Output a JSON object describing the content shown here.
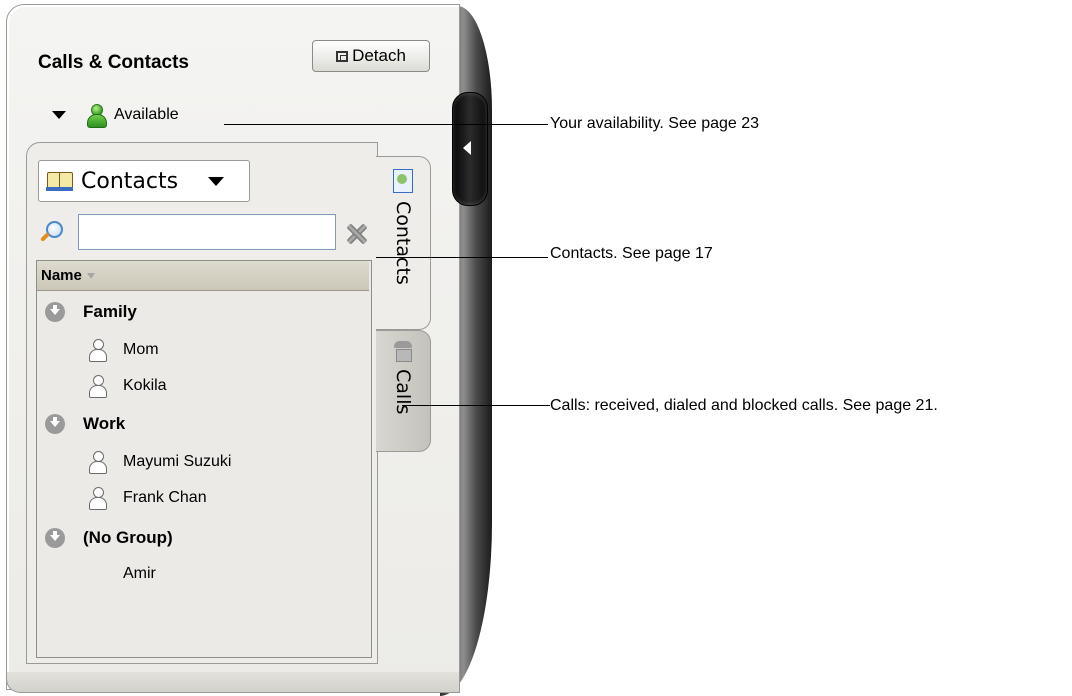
{
  "panel": {
    "title": "Calls & Contacts",
    "detach_label": "Detach"
  },
  "availability": {
    "status": "Available",
    "icon": "green-person-icon"
  },
  "source_dropdown": {
    "selected": "Contacts",
    "icon": "address-book-icon"
  },
  "search": {
    "value": "",
    "placeholder": ""
  },
  "list": {
    "column_header": "Name",
    "groups": [
      {
        "name": "Family",
        "members": [
          "Mom",
          "Kokila"
        ]
      },
      {
        "name": "Work",
        "members": [
          "Mayumi Suzuki",
          "Frank Chan"
        ]
      },
      {
        "name": "(No Group)",
        "members": [
          "Amir"
        ]
      }
    ]
  },
  "tabs": [
    {
      "label": "Contacts",
      "icon": "address-book-icon",
      "active": true
    },
    {
      "label": "Calls",
      "icon": "phone-icon",
      "active": false
    }
  ],
  "callouts": [
    {
      "text": "Your availability. See page 23"
    },
    {
      "text": "Contacts. See page 17"
    },
    {
      "text": "Calls: received, dialed and blocked calls. See page 21."
    }
  ]
}
